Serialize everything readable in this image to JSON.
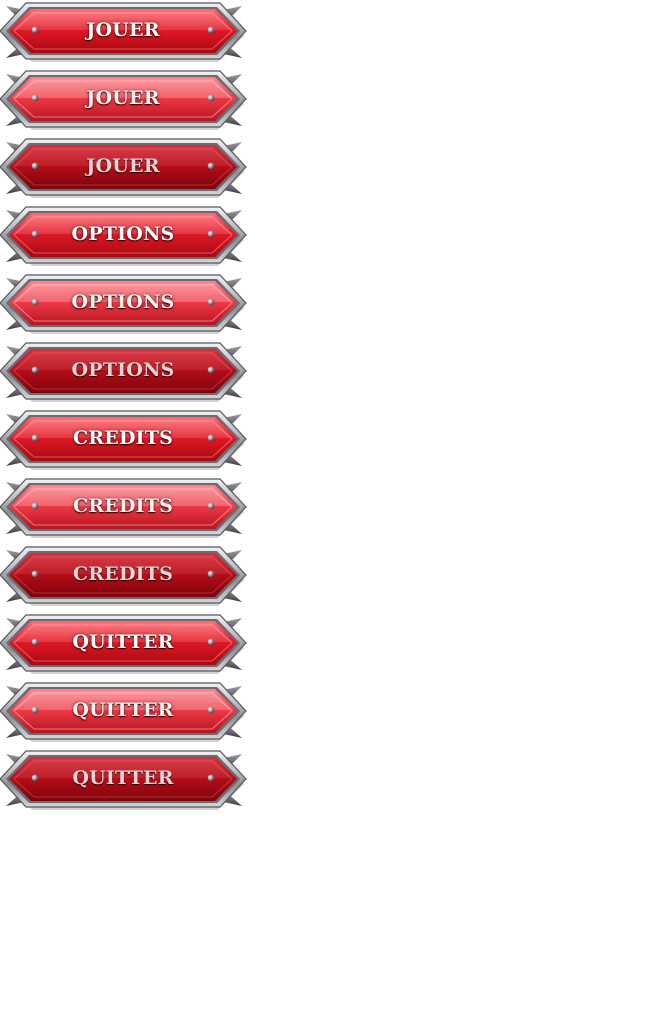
{
  "sprite_sheet": {
    "groups": [
      {
        "id": "jouer",
        "variants": [
          {
            "state": "normal",
            "label": "JOUER"
          },
          {
            "state": "hover",
            "label": "JOUER"
          },
          {
            "state": "pressed",
            "label": "JOUER"
          }
        ]
      },
      {
        "id": "options",
        "variants": [
          {
            "state": "normal",
            "label": "OPTIONS"
          },
          {
            "state": "hover",
            "label": "OPTIONS"
          },
          {
            "state": "pressed",
            "label": "OPTIONS"
          }
        ]
      },
      {
        "id": "credits",
        "variants": [
          {
            "state": "normal",
            "label": "CREDITS"
          },
          {
            "state": "hover",
            "label": "CREDITS"
          },
          {
            "state": "pressed",
            "label": "CREDITS"
          }
        ]
      },
      {
        "id": "quitter",
        "variants": [
          {
            "state": "normal",
            "label": "QUITTER"
          },
          {
            "state": "hover",
            "label": "QUITTER"
          },
          {
            "state": "pressed",
            "label": "QUITTER"
          }
        ]
      }
    ]
  },
  "colors": {
    "background": "#ffffff",
    "button_red": "#d9111f",
    "button_red_light": "#f4505a",
    "button_red_dark": "#8e0610",
    "frame_silver": "#c8c8cc",
    "frame_dark": "#5c5c62",
    "label_text": "#ffffff"
  },
  "icons": {
    "rivet": "rivet-icon",
    "spike": "spike-icon"
  }
}
